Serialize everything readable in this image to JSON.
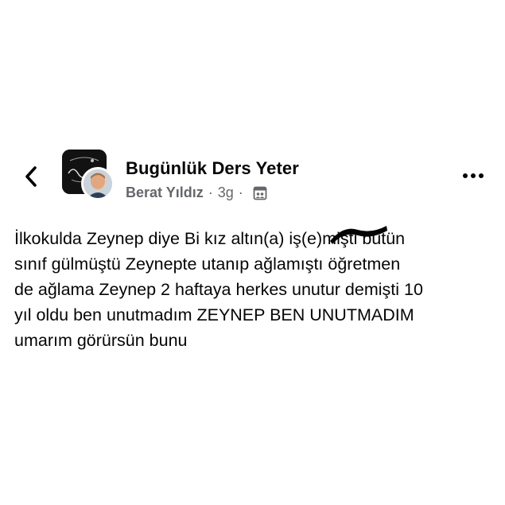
{
  "header": {
    "group_name": "Bugünlük Ders Yeter",
    "author": "Berat Yıldız",
    "separator": "·",
    "time": "3g",
    "back_icon": "chevron-left-icon",
    "more_icon": "more-horizontal-icon",
    "privacy_icon": "group-privacy-icon"
  },
  "post": {
    "lines": [
      "İlkokulda Zeynep diye Bi kız altın(a) iş(e)mişti bütün",
      "sınıf gülmüştü Zeynepte utanıp ağlamıştı öğretmen",
      "de ağlama Zeynep 2 haftaya herkes unutur demişti 10",
      "yıl oldu ben unutmadım ZEYNEP BEN UNUTMADIM",
      "umarım görürsün bunu"
    ]
  },
  "colors": {
    "text": "#050505",
    "secondary": "#65676b",
    "background": "#ffffff"
  }
}
